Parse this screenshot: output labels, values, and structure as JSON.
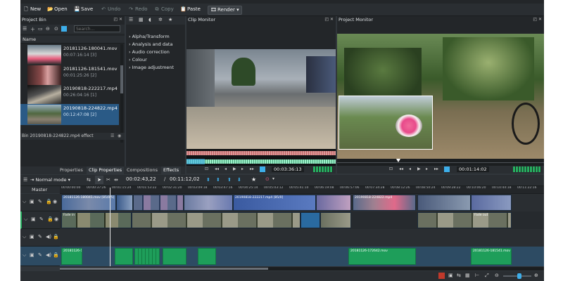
{
  "toolbar": {
    "new": "New",
    "open": "Open",
    "save": "Save",
    "undo": "Undo",
    "redo": "Redo",
    "copy": "Copy",
    "paste": "Paste",
    "render": "Render"
  },
  "project_bin": {
    "title": "Project Bin",
    "search_placeholder": "Search...",
    "column_name": "Name",
    "items": [
      {
        "name": "20181126-180041.mov",
        "duration": "00:07:16:14 [3]"
      },
      {
        "name": "20181126-181541.mov",
        "duration": "00:01:25:26 [2]"
      },
      {
        "name": "20190818-222217.mp4",
        "duration": "00:26:04:16 [1]"
      },
      {
        "name": "20190818-224822.mp4",
        "duration": "00:12:47:08 [2]"
      }
    ],
    "effect_bar": "Bin 20190818-224822.mp4 effect"
  },
  "effects": {
    "items": [
      "Alpha/Transform",
      "Analysis and data",
      "Audio correction",
      "Colour",
      "Image adjustment"
    ]
  },
  "tabs_left": {
    "properties": "Properties",
    "clip_properties": "Clip Properties"
  },
  "tabs_mid": {
    "compositions": "Compositions",
    "effects": "Effects"
  },
  "clip_monitor": {
    "title": "Clip Monitor",
    "timecode": "00:03:36:13"
  },
  "project_monitor": {
    "title": "Project Monitor",
    "timecode": "00:01:14:02"
  },
  "timeline": {
    "mode": "Normal mode",
    "pos": "00:02:43,22",
    "dur": "00:11:12,02",
    "master": "Master",
    "ticks": [
      "00:00:00:00",
      "00:00:37:26",
      "00:01:15:24",
      "00:01:53:22",
      "00:02:31:20",
      "00:03:09:18",
      "00:03:47:16",
      "00:04:25:14",
      "00:05:03:12",
      "00:05:41:10",
      "00:06:19:08",
      "00:06:57:06",
      "00:07:34:28",
      "00:08:12:26",
      "00:08:50:24",
      "00:09:28:22",
      "00:10:06:20",
      "00:10:44:18",
      "00:11:22:16"
    ],
    "clip1": "20181126-180041.mov [85/0/5]",
    "clip2": "20190818-222217.mp4 [85/0]",
    "clip3": "20190818-224822.mp4",
    "aclip1": "20181126-1",
    "aclip2": "20181126-172642.mov",
    "aclip3": "20181126-181541.mov",
    "fade_in": "Fade in",
    "fade_out": "Fade out"
  }
}
